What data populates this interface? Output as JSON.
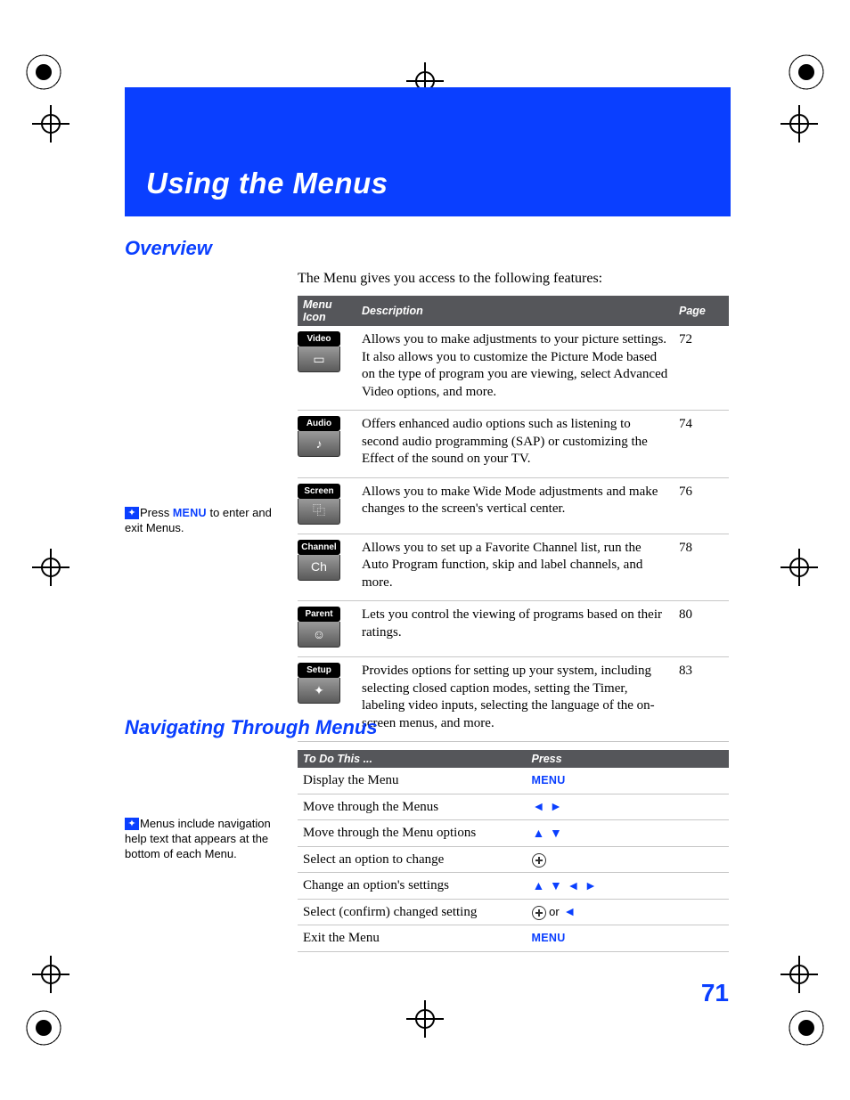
{
  "chapter_title": "Using the Menus",
  "sections": {
    "overview_heading": "Overview",
    "overview_intro": "The Menu gives you access to the following features:",
    "navigating_heading": "Navigating Through Menus"
  },
  "feature_table": {
    "headers": {
      "icon": "Menu Icon",
      "description": "Description",
      "page": "Page"
    },
    "rows": [
      {
        "icon_label": "Video",
        "glyph": "▭",
        "description": "Allows you to make adjustments to your picture settings. It also allows you to customize the Picture Mode based on the type of program you are viewing, select Advanced Video options, and more.",
        "page": "72"
      },
      {
        "icon_label": "Audio",
        "glyph": "♪",
        "description": "Offers enhanced audio options such as listening to second audio programming (SAP) or customizing the Effect of the sound on your TV.",
        "page": "74"
      },
      {
        "icon_label": "Screen",
        "glyph": "⿻",
        "description": "Allows you to make Wide Mode adjustments and make changes to the screen's vertical center.",
        "page": "76"
      },
      {
        "icon_label": "Channel",
        "glyph": "Ch",
        "description": "Allows you to set up a Favorite Channel list, run the Auto Program function, skip and label channels, and more.",
        "page": "78"
      },
      {
        "icon_label": "Parent",
        "glyph": "☺",
        "description": "Lets you control the viewing of programs based on their ratings.",
        "page": "80"
      },
      {
        "icon_label": "Setup",
        "glyph": "✦",
        "description": "Provides options for  setting up your system, including selecting closed caption modes, setting the Timer, labeling video inputs, selecting the language of the on-screen menus, and more.",
        "page": "83"
      }
    ]
  },
  "nav_table": {
    "headers": {
      "action": "To Do This ...",
      "press": "Press"
    },
    "rows": [
      {
        "action": "Display the Menu",
        "press_type": "menu"
      },
      {
        "action": "Move through the Menus",
        "press_type": "lr"
      },
      {
        "action": "Move through the Menu options",
        "press_type": "ud"
      },
      {
        "action": "Select an option to change",
        "press_type": "ring"
      },
      {
        "action": "Change an option's settings",
        "press_type": "udlr"
      },
      {
        "action": "Select (confirm) changed setting",
        "press_type": "ring_or_left",
        "or_text": " or "
      },
      {
        "action": "Exit the Menu",
        "press_type": "menu"
      }
    ],
    "menu_label": "MENU"
  },
  "tips": {
    "tip1_prefix": "Press ",
    "tip1_menu": "MENU",
    "tip1_suffix": " to enter and exit Menus.",
    "tip2": "Menus include navigation help text that appears at the bottom of each Menu."
  },
  "page_number": "71"
}
